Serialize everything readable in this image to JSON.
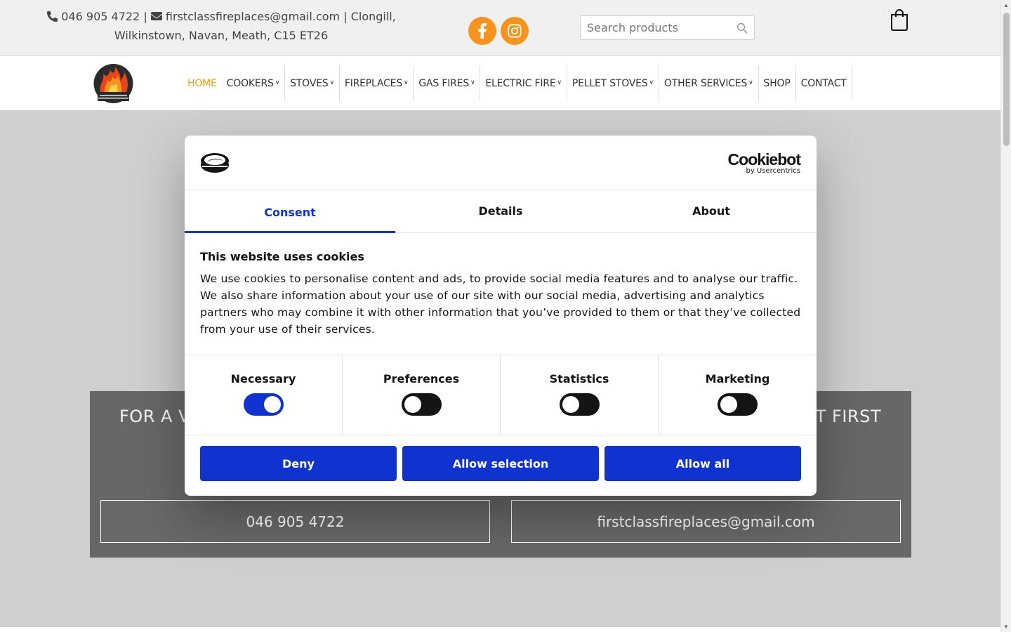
{
  "topbar": {
    "phone": "046 905 4722",
    "separator": "|",
    "email": "firstclassfireplaces@gmail.com",
    "address_part1": "Clongill,",
    "address_part2": "Wilkinstown, Navan, Meath, C15 ET26",
    "search_placeholder": "Search products"
  },
  "nav": {
    "items": [
      {
        "label": "HOME",
        "active": true
      },
      {
        "label": "COOKERS",
        "dropdown": true
      },
      {
        "label": "STOVES",
        "dropdown": true
      },
      {
        "label": "FIREPLACES",
        "dropdown": true
      },
      {
        "label": "GAS FIRES",
        "dropdown": true
      },
      {
        "label": "ELECTRIC FIRE",
        "dropdown": true
      },
      {
        "label": "PELLET STOVES",
        "dropdown": true
      },
      {
        "label": "OTHER SERVICES",
        "dropdown": true
      },
      {
        "label": "SHOP"
      },
      {
        "label": "CONTACT"
      }
    ]
  },
  "hero": {
    "text_left": "FOR A VA",
    "text_right": "CT FIRST",
    "phone_button": "046 905 4722",
    "email_button": "firstclassfireplaces@gmail.com"
  },
  "cookie": {
    "brand": "Cookiebot",
    "brand_sub": "by Usercentrics",
    "tabs": [
      "Consent",
      "Details",
      "About"
    ],
    "title": "This website uses cookies",
    "text": "We use cookies to personalise content and ads, to provide social media features and to analyse our traffic. We also share information about your use of our site with our social media, advertising and analytics partners who may combine it with other information that you’ve provided to them or that they’ve collected from your use of their services.",
    "toggles": [
      {
        "label": "Necessary",
        "on": true
      },
      {
        "label": "Preferences",
        "on": false
      },
      {
        "label": "Statistics",
        "on": false
      },
      {
        "label": "Marketing",
        "on": false
      }
    ],
    "buttons": {
      "deny": "Deny",
      "allow_selection": "Allow selection",
      "allow_all": "Allow all"
    }
  },
  "colors": {
    "accent": "#f7941d",
    "cookie_blue": "#1032cf",
    "hero_box": "#676767"
  },
  "icons": [
    "phone-icon",
    "envelope-icon",
    "facebook-icon",
    "instagram-icon",
    "search-icon",
    "shopping-bag-icon",
    "flame-logo",
    "cookiebot-logo"
  ]
}
